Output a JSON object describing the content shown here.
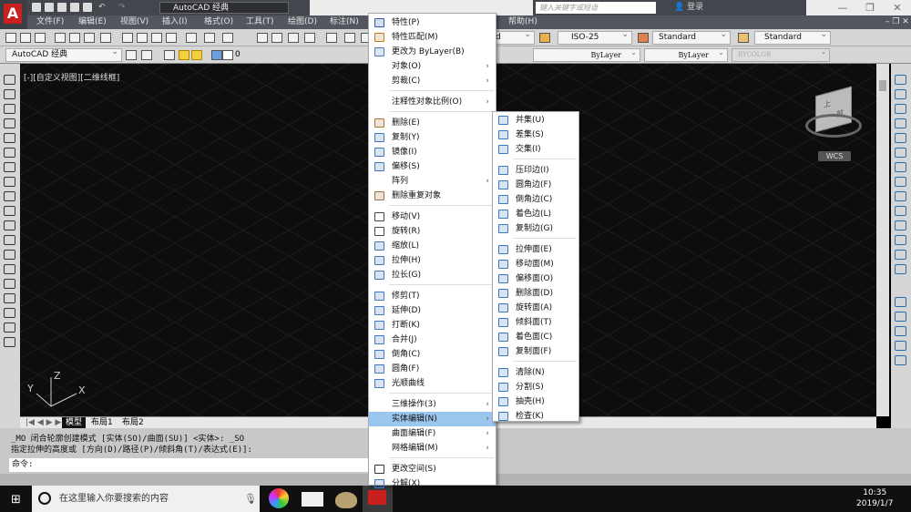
{
  "title_bar": {
    "workspace": "AutoCAD 经典",
    "search_placeholder": "键入关键字或短语",
    "login": "登录"
  },
  "menubar": [
    "文件(F)",
    "编辑(E)",
    "视图(V)",
    "插入(I)",
    "格式(O)",
    "工具(T)",
    "绘图(D)",
    "标注(N)",
    "帮助(H)"
  ],
  "toolbar": {
    "dim_style": "ISO-25",
    "text_style": "Standard",
    "table_style": "Standard",
    "partial_style": "d"
  },
  "properties": {
    "workspace": "AutoCAD 经典",
    "layer": "0",
    "linetype": "ByLayer",
    "lineweight": "ByLayer",
    "plotstyle": "BYCOLOR"
  },
  "viewport_label": "[-][自定义视图][二维线框]",
  "viewcube": {
    "top": "上",
    "front": "前",
    "wcs": "WCS"
  },
  "ucs": {
    "x": "X",
    "y": "Y",
    "z": "Z"
  },
  "tabs": [
    "模型",
    "布局1",
    "布局2"
  ],
  "command": {
    "line1": "_MO 闭合轮廓创建模式 [实体(SO)/曲面(SU)] <实体>: _SO",
    "line2": "指定拉伸的高度或 [方向(D)/路径(P)/倾斜角(T)/表达式(E)]:",
    "prompt": "命令:"
  },
  "context_menu": [
    {
      "label": "特性(P)",
      "icon": "properties-icon",
      "color": "#2a5aa8"
    },
    {
      "label": "特性匹配(M)",
      "icon": "match-properties-icon",
      "color": "#c07a20"
    },
    {
      "label": "更改为 ByLayer(B)",
      "icon": "bylayer-icon",
      "color": "#4a7ab8"
    },
    {
      "label": "对象(O)",
      "submenu": true
    },
    {
      "label": "剪裁(C)",
      "submenu": true
    },
    {
      "sep": true
    },
    {
      "label": "注释性对象比例(O)",
      "submenu": true
    },
    {
      "sep": true
    },
    {
      "label": "删除(E)",
      "icon": "erase-icon",
      "color": "#b07030"
    },
    {
      "label": "复制(Y)",
      "icon": "copy-icon",
      "color": "#3a78c0"
    },
    {
      "label": "镜像(I)",
      "icon": "mirror-icon",
      "color": "#3a78c0"
    },
    {
      "label": "偏移(S)",
      "icon": "offset-icon",
      "color": "#3a78c0"
    },
    {
      "label": "阵列",
      "submenu": true
    },
    {
      "label": "删除重复对象",
      "icon": "overkill-icon",
      "color": "#a07040"
    },
    {
      "sep": true
    },
    {
      "label": "移动(V)",
      "icon": "move-icon",
      "color": "#444"
    },
    {
      "label": "旋转(R)",
      "icon": "rotate-icon",
      "color": "#444"
    },
    {
      "label": "缩放(L)",
      "icon": "scale-icon",
      "color": "#3a78c0"
    },
    {
      "label": "拉伸(H)",
      "icon": "stretch-icon",
      "color": "#3a78c0"
    },
    {
      "label": "拉长(G)",
      "icon": "lengthen-icon",
      "color": "#3a78c0"
    },
    {
      "sep": true
    },
    {
      "label": "修剪(T)",
      "icon": "trim-icon",
      "color": "#3a78c0"
    },
    {
      "label": "延伸(D)",
      "icon": "extend-icon",
      "color": "#3a78c0"
    },
    {
      "label": "打断(K)",
      "icon": "break-icon",
      "color": "#3a78c0"
    },
    {
      "label": "合并(J)",
      "icon": "join-icon",
      "color": "#3a78c0"
    },
    {
      "label": "倒角(C)",
      "icon": "chamfer-icon",
      "color": "#3a78c0"
    },
    {
      "label": "圆角(F)",
      "icon": "fillet-icon",
      "color": "#3a78c0"
    },
    {
      "label": "光顺曲线",
      "icon": "blend-curves-icon",
      "color": "#3a78c0"
    },
    {
      "sep": true
    },
    {
      "label": "三维操作(3)",
      "submenu": true
    },
    {
      "label": "实体编辑(N)",
      "submenu": true,
      "highlighted": true
    },
    {
      "label": "曲面编辑(F)",
      "submenu": true
    },
    {
      "label": "网格编辑(M)",
      "submenu": true
    },
    {
      "sep": true
    },
    {
      "label": "更改空间(S)",
      "icon": "change-space-icon",
      "color": "#333"
    },
    {
      "label": "分解(X)",
      "icon": "explode-icon",
      "color": "#3a78c0"
    }
  ],
  "solid_edit_submenu": [
    {
      "label": "并集(U)",
      "icon": "union-icon"
    },
    {
      "label": "差集(S)",
      "icon": "subtract-icon"
    },
    {
      "label": "交集(I)",
      "icon": "intersect-icon"
    },
    {
      "sep": true
    },
    {
      "label": "压印边(I)",
      "icon": "imprint-icon"
    },
    {
      "label": "圆角边(F)",
      "icon": "fillet-edge-icon"
    },
    {
      "label": "倒角边(C)",
      "icon": "chamfer-edge-icon"
    },
    {
      "label": "着色边(L)",
      "icon": "color-edge-icon"
    },
    {
      "label": "复制边(G)",
      "icon": "copy-edge-icon"
    },
    {
      "sep": true
    },
    {
      "label": "拉伸面(E)",
      "icon": "extrude-face-icon"
    },
    {
      "label": "移动面(M)",
      "icon": "move-face-icon"
    },
    {
      "label": "偏移面(O)",
      "icon": "offset-face-icon"
    },
    {
      "label": "删除面(D)",
      "icon": "delete-face-icon"
    },
    {
      "label": "旋转面(A)",
      "icon": "rotate-face-icon"
    },
    {
      "label": "倾斜面(T)",
      "icon": "taper-face-icon"
    },
    {
      "label": "着色面(C)",
      "icon": "color-face-icon"
    },
    {
      "label": "复制面(F)",
      "icon": "copy-face-icon"
    },
    {
      "sep": true
    },
    {
      "label": "清除(N)",
      "icon": "clean-icon"
    },
    {
      "label": "分割(S)",
      "icon": "separate-icon"
    },
    {
      "label": "抽壳(H)",
      "icon": "shell-icon"
    },
    {
      "label": "检查(K)",
      "icon": "check-icon"
    }
  ],
  "taskbar": {
    "search_placeholder": "在这里输入你要搜索的内容",
    "time": "10:35",
    "date": "2019/1/7"
  },
  "colors": {
    "accent": "#c8201e",
    "highlight": "#9bc6ef"
  }
}
